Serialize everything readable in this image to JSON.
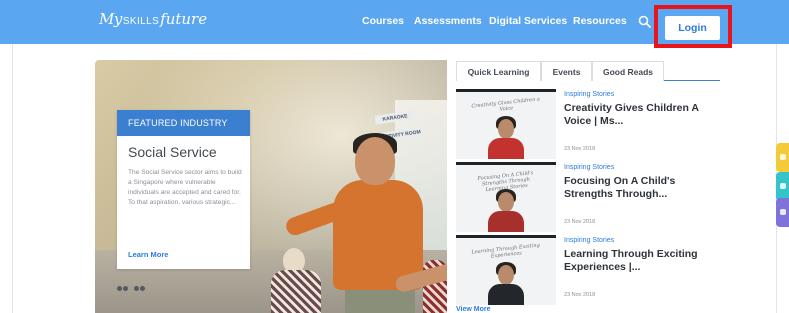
{
  "brand": {
    "logo_my": "My",
    "logo_skills": "SKILLS",
    "logo_future": "future"
  },
  "nav": {
    "links": [
      "Courses",
      "Assessments",
      "Digital Services",
      "Resources"
    ],
    "search_icon": "search-icon",
    "login_label": "Login"
  },
  "colors": {
    "nav_bg": "#5aa6f0",
    "accent": "#2d7be0",
    "badge": "#3a7fd0",
    "highlight": "#e8141b"
  },
  "hero": {
    "signs": [
      "KARAOKE",
      "ACTIVITY ROOM"
    ]
  },
  "featured": {
    "badge": "FEATURED INDUSTRY",
    "title": "Social Service",
    "description": "The Social Service sector aims to build a Singapore where vulnerable individuals are accepted and cared for. To that aspiration, various strategic...",
    "link": "Learn More"
  },
  "tabs": [
    "Quick Learning",
    "Events",
    "Good Reads"
  ],
  "stories": [
    {
      "thumb_caption": "Creativity Gives Children a Voice",
      "category": "Inspiring Stories",
      "title": "Creativity Gives Children A Voice | Ms...",
      "date": "23 Nov 2018"
    },
    {
      "thumb_caption": "Focusing On A Child's Strengths Through Learning Stories",
      "category": "Inspiring Stories",
      "title": "Focusing On A Child's Strengths Through...",
      "date": "23 Nov 2018"
    },
    {
      "thumb_caption": "Learning Through Exciting Experiences",
      "category": "Inspiring Stories",
      "title": "Learning Through Exciting Experiences |...",
      "date": "23 Nov 2018"
    }
  ],
  "view_more": "View More",
  "side_widgets": [
    {
      "color": "#f4c93a",
      "icon": "chat-icon"
    },
    {
      "color": "#35c4c9",
      "icon": "feedback-icon"
    },
    {
      "color": "#7f73d9",
      "icon": "help-icon"
    }
  ]
}
